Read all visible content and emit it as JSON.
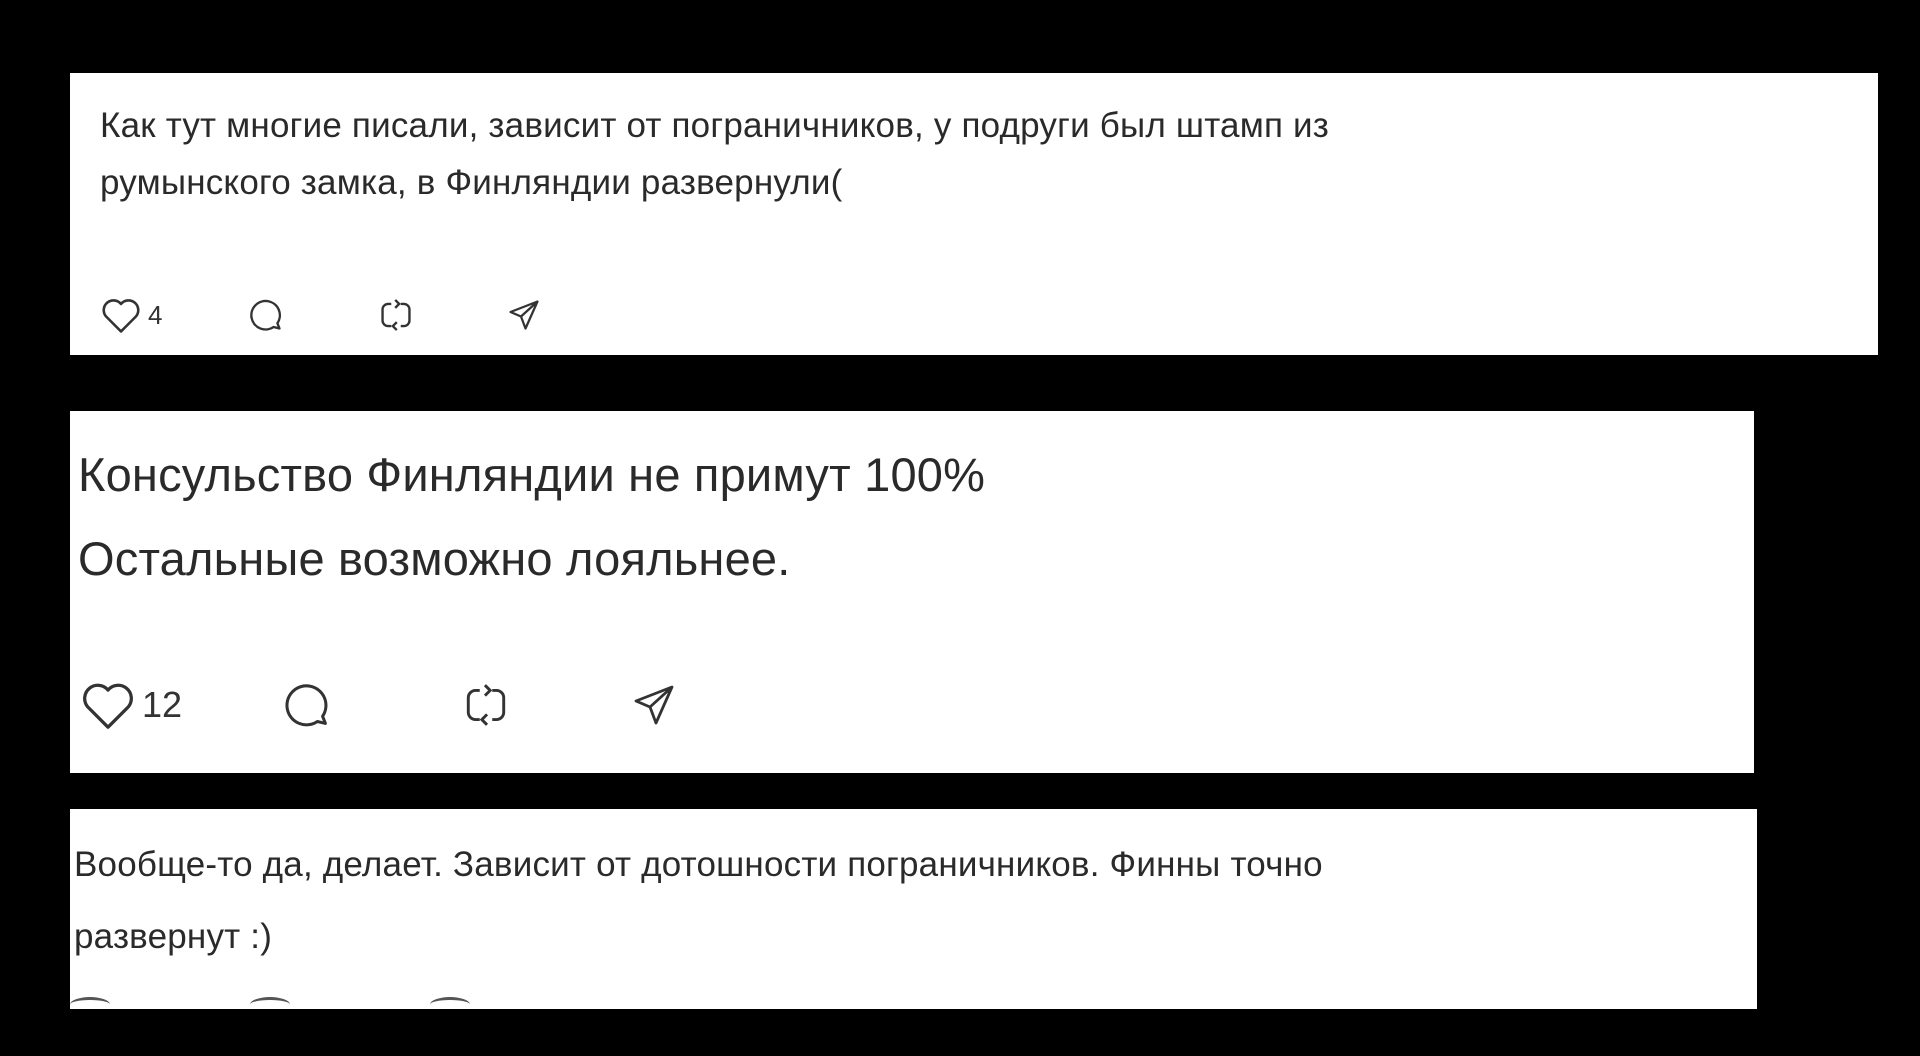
{
  "posts": [
    {
      "text": "Как тут многие писали, зависит от пограничников, у подруги был штамп из\nрумынского замка, в Финляндии развернули(",
      "likes": "4",
      "icons": [
        "heart-icon",
        "comment-icon",
        "repost-icon",
        "share-icon"
      ]
    },
    {
      "text": "Консульство Финляндии не примут 100%\nОстальные возможно лояльнее.",
      "likes": "12",
      "icons": [
        "heart-icon",
        "comment-icon",
        "repost-icon",
        "share-icon"
      ]
    },
    {
      "text": "Вообще-то да, делает. Зависит от дотошности пограничников. Финны точно\nразвернут :)"
    }
  ],
  "colors": {
    "background": "#000000",
    "card": "#ffffff",
    "text": "#2a2a2a",
    "icon": "#333333"
  }
}
